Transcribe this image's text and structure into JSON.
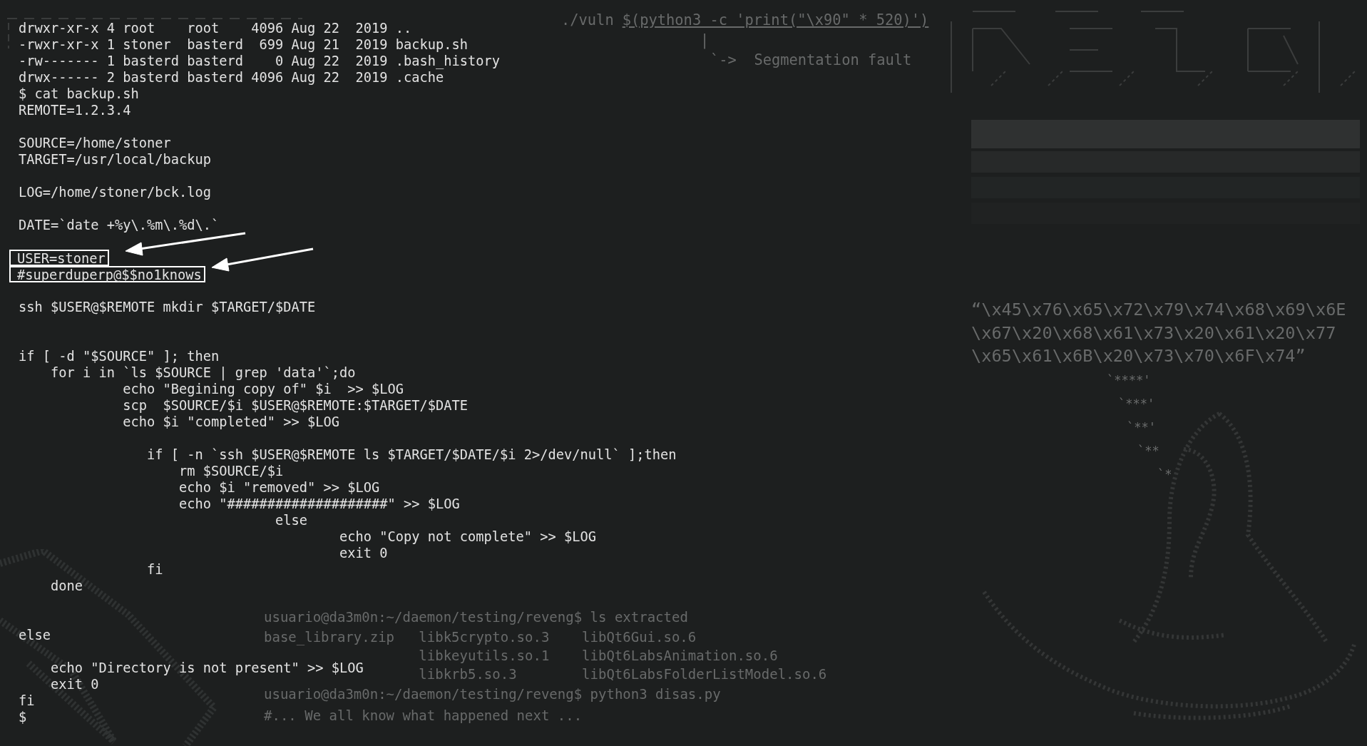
{
  "terminal": {
    "lines": [
      {
        "kind": "text",
        "text": "drwxr-xr-x 4 root    root    4096 Aug 22  2019 ..",
        "highlighted": false
      },
      {
        "kind": "text",
        "text": "-rwxr-xr-x 1 stoner  basterd  699 Aug 21  2019 backup.sh",
        "highlighted": false
      },
      {
        "kind": "text",
        "text": "-rw------- 1 basterd basterd    0 Aug 22  2019 .bash_history",
        "highlighted": false
      },
      {
        "kind": "text",
        "text": "drwx------ 2 basterd basterd 4096 Aug 22  2019 .cache",
        "highlighted": false
      },
      {
        "kind": "text",
        "text": "$ cat backup.sh",
        "highlighted": false
      },
      {
        "kind": "text",
        "text": "REMOTE=1.2.3.4",
        "highlighted": false
      },
      {
        "kind": "blank"
      },
      {
        "kind": "text",
        "text": "SOURCE=/home/stoner",
        "highlighted": false
      },
      {
        "kind": "text",
        "text": "TARGET=/usr/local/backup",
        "highlighted": false
      },
      {
        "kind": "blank"
      },
      {
        "kind": "text",
        "text": "LOG=/home/stoner/bck.log",
        "highlighted": false
      },
      {
        "kind": "blank"
      },
      {
        "kind": "text",
        "text": "DATE=`date +%y\\.%m\\.%d\\.`",
        "highlighted": false
      },
      {
        "kind": "blank"
      },
      {
        "kind": "text",
        "text": "USER=stoner",
        "highlighted": true
      },
      {
        "kind": "text",
        "text": "#superduperp@$$no1knows",
        "highlighted": true
      },
      {
        "kind": "blank"
      },
      {
        "kind": "text",
        "text": "ssh $USER@$REMOTE mkdir $TARGET/$DATE",
        "highlighted": false
      },
      {
        "kind": "blank"
      },
      {
        "kind": "blank"
      },
      {
        "kind": "text",
        "text": "if [ -d \"$SOURCE\" ]; then",
        "highlighted": false
      },
      {
        "kind": "text",
        "text": "    for i in `ls $SOURCE | grep 'data'`;do",
        "highlighted": false
      },
      {
        "kind": "text",
        "text": "             echo \"Begining copy of\" $i  >> $LOG",
        "highlighted": false
      },
      {
        "kind": "text",
        "text": "             scp  $SOURCE/$i $USER@$REMOTE:$TARGET/$DATE",
        "highlighted": false
      },
      {
        "kind": "text",
        "text": "             echo $i \"completed\" >> $LOG",
        "highlighted": false
      },
      {
        "kind": "blank"
      },
      {
        "kind": "text",
        "text": "                if [ -n `ssh $USER@$REMOTE ls $TARGET/$DATE/$i 2>/dev/null` ];then",
        "highlighted": false
      },
      {
        "kind": "text",
        "text": "                    rm $SOURCE/$i",
        "highlighted": false
      },
      {
        "kind": "text",
        "text": "                    echo $i \"removed\" >> $LOG",
        "highlighted": false
      },
      {
        "kind": "text",
        "text": "                    echo \"####################\" >> $LOG",
        "highlighted": false
      },
      {
        "kind": "text",
        "text": "                                else",
        "highlighted": false
      },
      {
        "kind": "text",
        "text": "                                        echo \"Copy not complete\" >> $LOG",
        "highlighted": false
      },
      {
        "kind": "text",
        "text": "                                        exit 0",
        "highlighted": false
      },
      {
        "kind": "text",
        "text": "                fi",
        "highlighted": false
      },
      {
        "kind": "text",
        "text": "    done",
        "highlighted": false
      },
      {
        "kind": "blank"
      },
      {
        "kind": "blank"
      },
      {
        "kind": "text",
        "text": "else",
        "highlighted": false
      },
      {
        "kind": "blank"
      },
      {
        "kind": "text",
        "text": "    echo \"Directory is not present\" >> $LOG",
        "highlighted": false
      },
      {
        "kind": "text",
        "text": "    exit 0",
        "highlighted": false
      },
      {
        "kind": "text",
        "text": "fi",
        "highlighted": false
      },
      {
        "kind": "text",
        "text": "$",
        "highlighted": false
      }
    ]
  },
  "wallpaper": {
    "command": {
      "program": "./vuln",
      "argument": "$(python3 -c 'print(\"\\x90\" * 520)')"
    },
    "pipe": "|",
    "result": "`->  Segmentation fault",
    "hex_quote": [
      "“\\x45\\x76\\x65\\x72\\x79\\x74\\x68\\x69\\x6E",
      "\\x67\\x20\\x68\\x61\\x73\\x20\\x61\\x20\\x77",
      "\\x65\\x61\\x6B\\x20\\x73\\x70\\x6F\\x74”"
    ],
    "stars": [
      "`****'",
      "`***'",
      "`**'",
      "`**",
      "`*"
    ],
    "session": [
      {
        "kind": "prompt",
        "text": "usuario@da3m0n:~/daemon/testing/reveng$ ls extracted"
      },
      {
        "kind": "files",
        "files": [
          "base_library.zip",
          "libk5crypto.so.3",
          "libQt6Gui.so.6"
        ]
      },
      {
        "kind": "files",
        "files": [
          "libkeyutils.so.1",
          "libQt6LabsAnimation.so.6"
        ]
      },
      {
        "kind": "files",
        "files": [
          "libkrb5.so.3",
          "libQt6LabsFolderListModel.so.6"
        ]
      },
      {
        "kind": "prompt",
        "text": "usuario@da3m0n:~/daemon/testing/reveng$ python3 disas.py"
      },
      {
        "kind": "prompt",
        "text": "#... We all know what happened next ..."
      }
    ]
  }
}
